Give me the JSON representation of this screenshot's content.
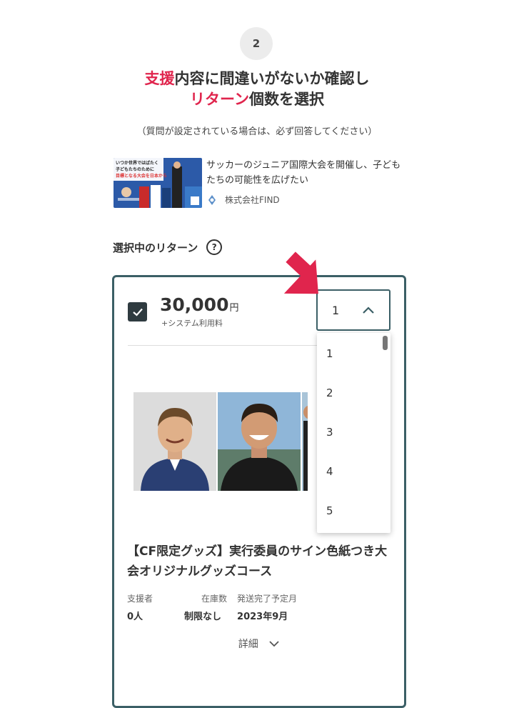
{
  "step": {
    "number": "2"
  },
  "heading": {
    "line1_hl": "支援",
    "line1_rest": "内容に間違いがないか確認し",
    "line2_hl": "リターン",
    "line2_rest": "個数を選択"
  },
  "note": "（質問が設定されている場合は、必ず回答してください）",
  "project": {
    "thumbnail_text": "いつか世界ではばたく子どもたちのために目標となる大会を日本から",
    "title": "サッカーのジュニア国際大会を開催し、子どもたちの可能性を広げたい",
    "organization": "株式会社FIND"
  },
  "selected": {
    "label": "選択中のリターン",
    "help_glyph": "?"
  },
  "reward": {
    "price": "30,000",
    "currency": "円",
    "fee_note": "+システム利用料",
    "quantity": "1",
    "title": "【CF限定グッズ】実行委員のサイン色紙つき大会オリジナルグッズコース",
    "stats": [
      {
        "key": "支援者",
        "value": "0人"
      },
      {
        "key": "在庫数",
        "value": "制限なし"
      },
      {
        "key": "発送完了予定月",
        "value": "2023年9月"
      }
    ],
    "details_label": "詳細"
  },
  "dropdown": {
    "options": [
      "1",
      "2",
      "3",
      "4",
      "5"
    ]
  },
  "colors": {
    "accent": "#e0254d",
    "border": "#3b5f66",
    "checkbox": "#2f3b40"
  }
}
